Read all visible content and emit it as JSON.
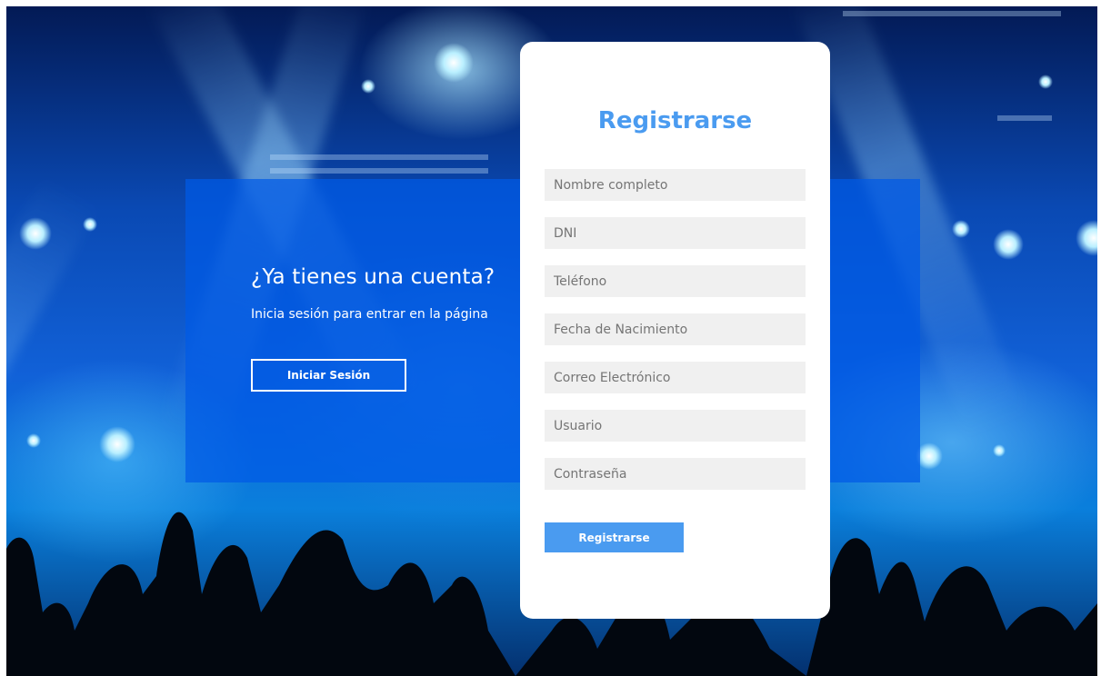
{
  "colors": {
    "accent": "#4a9bf0",
    "panel": "#0a5ae6",
    "card_background": "#ffffff",
    "input_background": "#f0f0f0"
  },
  "info_panel": {
    "title": "¿Ya tienes una cuenta?",
    "text": "Inicia sesión para entrar en la página",
    "login_button": "Iniciar Sesión"
  },
  "register_form": {
    "title": "Registrarse",
    "fields": [
      {
        "name": "full-name",
        "placeholder": "Nombre completo"
      },
      {
        "name": "dni",
        "placeholder": "DNI"
      },
      {
        "name": "phone",
        "placeholder": "Teléfono"
      },
      {
        "name": "birthdate",
        "placeholder": "Fecha de Nacimiento"
      },
      {
        "name": "email",
        "placeholder": "Correo Electrónico"
      },
      {
        "name": "username",
        "placeholder": "Usuario"
      },
      {
        "name": "password",
        "placeholder": "Contraseña"
      }
    ],
    "submit_button": "Registrarse"
  }
}
